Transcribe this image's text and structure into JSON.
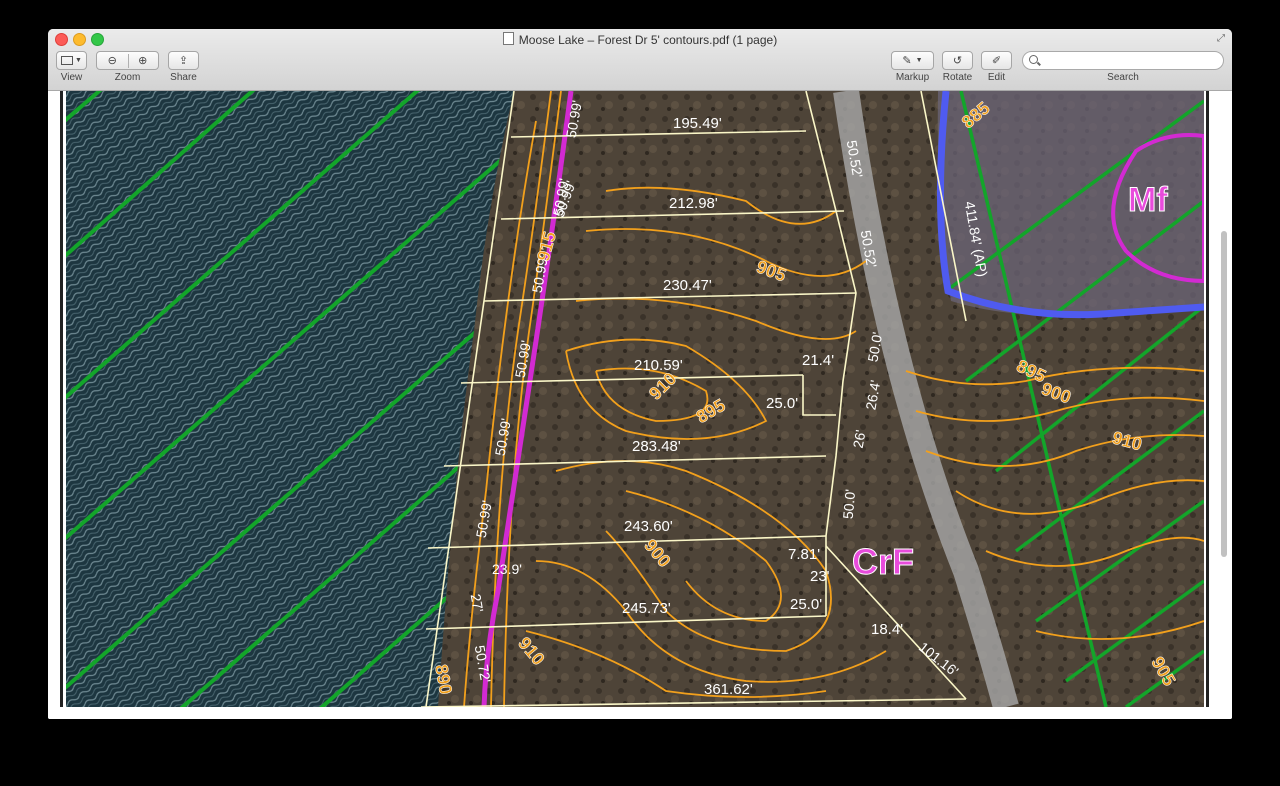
{
  "window": {
    "title": "Moose Lake – Forest Dr 5' contours.pdf (1 page)"
  },
  "toolbar": {
    "view_label": "View",
    "zoom_label": "Zoom",
    "share_label": "Share",
    "markup_label": "Markup",
    "rotate_label": "Rotate",
    "edit_label": "Edit",
    "search_label": "Search",
    "search_value": ""
  },
  "colors": {
    "lake": "#1d3640",
    "land": "#4e4438",
    "contour": "#f2a01c",
    "hatch": "#13a52a",
    "parcel": "#fbf7c8",
    "boundary": "#d22ad2",
    "zone": "#4f5bf0"
  },
  "map": {
    "soil_labels": [
      "Mf",
      "CrF"
    ],
    "lot_dims": [
      "195.49'",
      "212.98'",
      "230.47'",
      "210.59'",
      "283.48'",
      "243.60'",
      "245.73'",
      "361.62'"
    ],
    "side_dims": [
      "50.99'",
      "50.99'",
      "50.99'",
      "50.99'",
      "50.99'",
      "50.99'",
      "50.99'",
      "23.9'",
      "27'",
      "50.72'"
    ],
    "east_dims": [
      "50.52'",
      "50.52'",
      "50.0'",
      "26.4'",
      "26'",
      "50.0'",
      "21.4'",
      "25.0'",
      "7.81'",
      "23'",
      "25.0'",
      "18.4'",
      "101.16'",
      "411.84' (AP)"
    ],
    "elevations": [
      "885",
      "905",
      "895",
      "910",
      "900",
      "910",
      "890",
      "895",
      "900",
      "910",
      "905",
      "915"
    ]
  }
}
